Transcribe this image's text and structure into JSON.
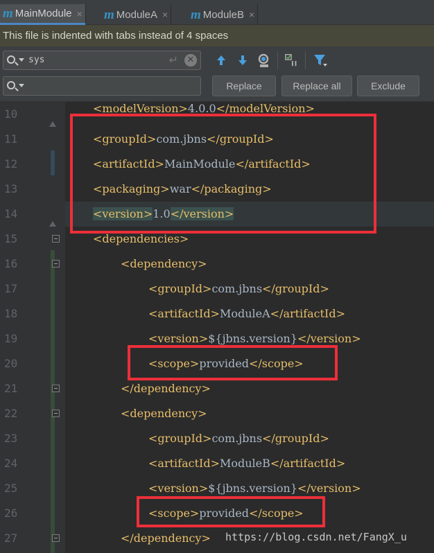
{
  "tabs": [
    {
      "label": "MainModule",
      "close": "×",
      "active": true
    },
    {
      "label": "ModuleA",
      "close": "×",
      "active": false
    },
    {
      "label": "ModuleB",
      "close": "×",
      "active": false
    }
  ],
  "tab_icon_letter": "m",
  "notification": "This file is indented with tabs instead of 4 spaces",
  "find": {
    "search_value": "sys",
    "replace_value": "",
    "enter_symbol": "↵",
    "clear_symbol": "✕"
  },
  "buttons": {
    "replace": "Replace",
    "replace_all": "Replace all",
    "exclude": "Exclude"
  },
  "toolbar_icons": [
    "arrow-up-icon",
    "arrow-down-icon",
    "find-all-icon",
    "select-all-occurrences-icon",
    "filter-icon"
  ],
  "lines": [
    {
      "n": "10",
      "parts": [
        [
          "t",
          "<modelVersion>"
        ],
        [
          "x",
          "4.0.0"
        ],
        [
          "t",
          "</modelVersion>"
        ]
      ]
    },
    {
      "n": "11",
      "parts": [
        [
          "t",
          "<groupId>"
        ],
        [
          "x",
          "com.jbns"
        ],
        [
          "t",
          "</groupId>"
        ]
      ]
    },
    {
      "n": "12",
      "parts": [
        [
          "t",
          "<artifactId>"
        ],
        [
          "x",
          "MainModule"
        ],
        [
          "t",
          "</artifactId>"
        ]
      ]
    },
    {
      "n": "13",
      "parts": [
        [
          "t",
          "<packaging>"
        ],
        [
          "x",
          "war"
        ],
        [
          "t",
          "</packaging>"
        ]
      ]
    },
    {
      "n": "14",
      "parts": [
        [
          "m",
          "<version>"
        ],
        [
          "x",
          "1.0"
        ],
        [
          "m",
          "</version>"
        ]
      ]
    },
    {
      "n": "15",
      "parts": [
        [
          "t",
          "<dependencies>"
        ]
      ]
    },
    {
      "n": "16",
      "parts": [
        [
          "t",
          "<dependency>"
        ]
      ]
    },
    {
      "n": "17",
      "parts": [
        [
          "t",
          "<groupId>"
        ],
        [
          "x",
          "com.jbns"
        ],
        [
          "t",
          "</groupId>"
        ]
      ]
    },
    {
      "n": "18",
      "parts": [
        [
          "t",
          "<artifactId>"
        ],
        [
          "x",
          "ModuleA"
        ],
        [
          "t",
          "</artifactId>"
        ]
      ]
    },
    {
      "n": "19",
      "parts": [
        [
          "t",
          "<version>"
        ],
        [
          "x",
          "${jbns.version}"
        ],
        [
          "t",
          "</version>"
        ]
      ]
    },
    {
      "n": "20",
      "parts": [
        [
          "t",
          "<scope>"
        ],
        [
          "x",
          "provided"
        ],
        [
          "t",
          "</scope>"
        ]
      ]
    },
    {
      "n": "21",
      "parts": [
        [
          "t",
          "</dependency>"
        ]
      ]
    },
    {
      "n": "22",
      "parts": [
        [
          "t",
          "<dependency>"
        ]
      ]
    },
    {
      "n": "23",
      "parts": [
        [
          "t",
          "<groupId>"
        ],
        [
          "x",
          "com.jbns"
        ],
        [
          "t",
          "</groupId>"
        ]
      ]
    },
    {
      "n": "24",
      "parts": [
        [
          "t",
          "<artifactId>"
        ],
        [
          "x",
          "ModuleB"
        ],
        [
          "t",
          "</artifactId>"
        ]
      ]
    },
    {
      "n": "25",
      "parts": [
        [
          "t",
          "<version>"
        ],
        [
          "x",
          "${jbns.version}"
        ],
        [
          "t",
          "</version>"
        ]
      ]
    },
    {
      "n": "26",
      "parts": [
        [
          "t",
          "<scope>"
        ],
        [
          "x",
          "provided"
        ],
        [
          "t",
          "</scope>"
        ]
      ]
    },
    {
      "n": "27",
      "parts": [
        [
          "t",
          "</dependency>"
        ]
      ]
    }
  ],
  "watermark": "https://blog.csdn.net/FangX_u",
  "colors": {
    "tag": "#e8bf6a",
    "text": "#a9b7c6",
    "highlight_box": "#ec2f3a",
    "tab_accent": "#4a88c7"
  }
}
